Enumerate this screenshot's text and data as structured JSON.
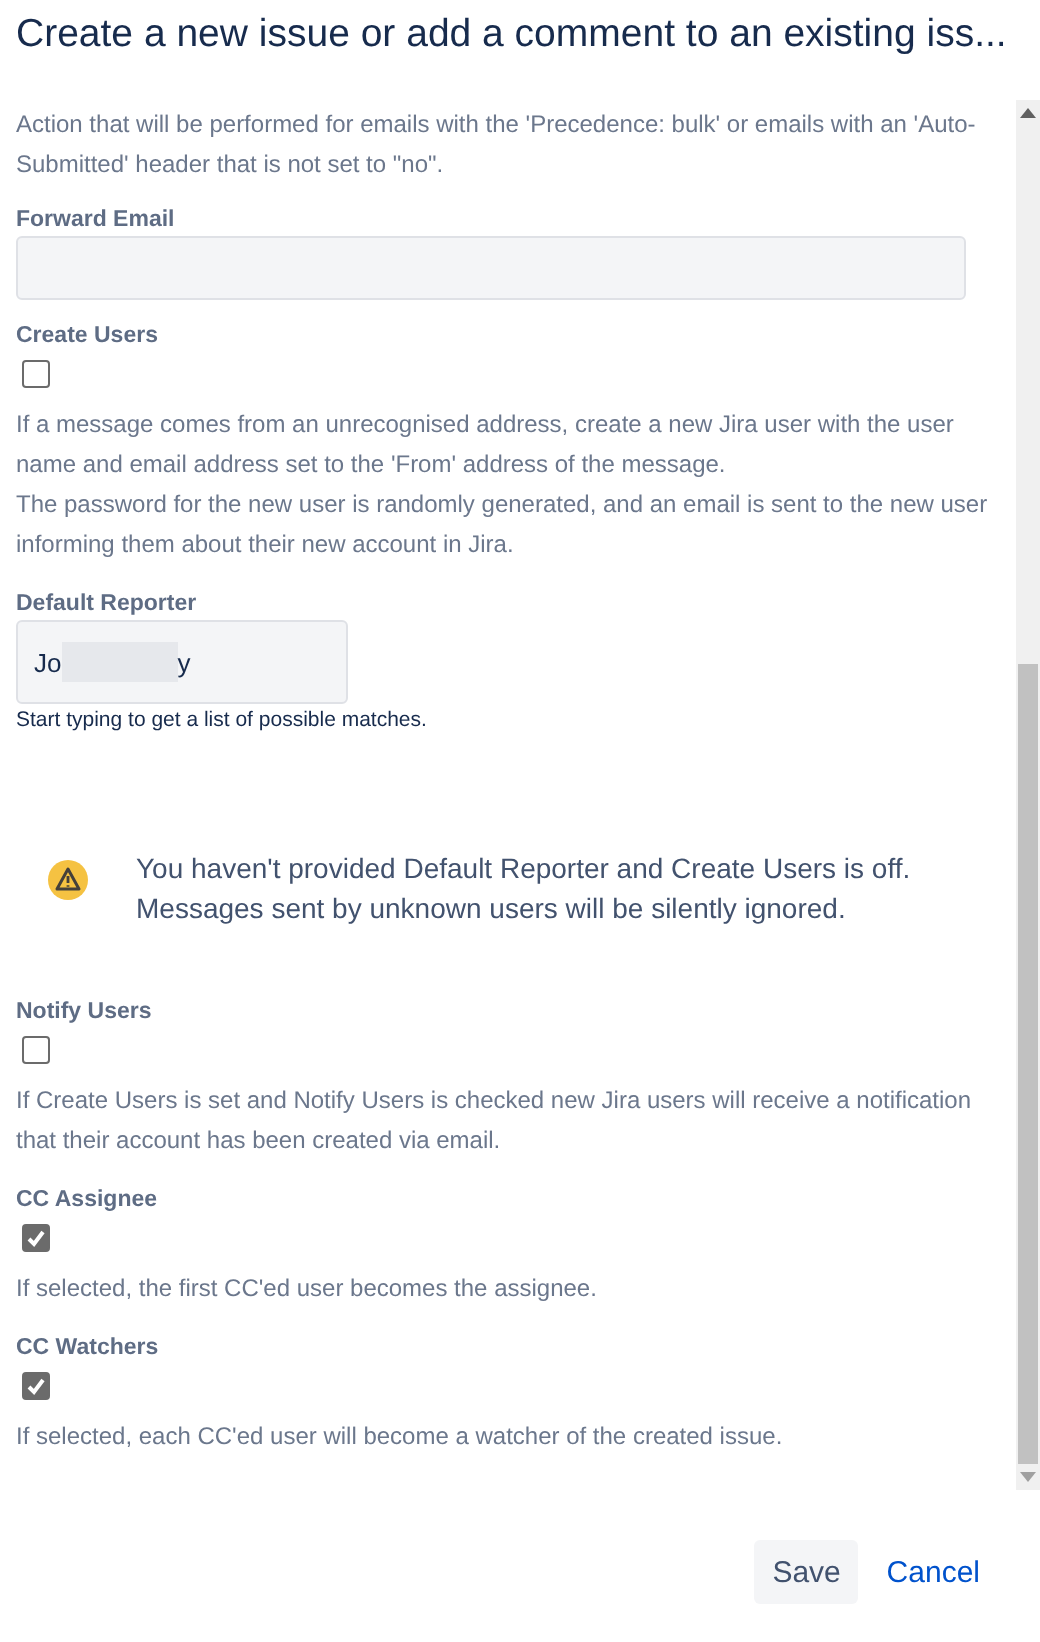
{
  "dialog": {
    "title": "Create a new issue or add a comment to an existing iss..."
  },
  "fields": [
    {
      "kind": "text",
      "description": "Action that will be performed for emails with the 'Precedence: bulk' or emails with an 'Auto-Submitted' header that is not set to \"no\"."
    },
    {
      "kind": "input",
      "label": "Forward Email"
    },
    {
      "kind": "checkbox",
      "label": "Create Users",
      "checked": false,
      "description": [
        "If a message comes from an unrecognised address, create a new Jira user with the user name and email address set to the 'From' address of the message.",
        "The password for the new user is randomly generated, and an email is sent to the new user informing them about their new account in Jira."
      ]
    },
    {
      "kind": "user",
      "label": "Default Reporter",
      "value_start": "Jo",
      "value_end": "y",
      "hint": "Start typing to get a list of possible matches."
    },
    {
      "kind": "warning",
      "message": "You haven't provided Default Reporter and Create Users is off. Messages sent by unknown users will be silently ignored."
    },
    {
      "kind": "checkbox",
      "label": "Notify Users",
      "checked": false,
      "description": [
        "If Create Users is set and Notify Users is checked new Jira users will receive a notification that their account has been created via email."
      ]
    },
    {
      "kind": "checkbox",
      "label": "CC Assignee",
      "checked": true,
      "description": [
        "If selected, the first CC'ed user becomes the assignee."
      ]
    },
    {
      "kind": "checkbox",
      "label": "CC Watchers",
      "checked": true,
      "description": [
        "If selected, each CC'ed user will become a watcher of the created issue."
      ]
    }
  ],
  "buttons": [
    {
      "kind": "primary",
      "label": "Save"
    },
    {
      "kind": "link",
      "label": "Cancel"
    }
  ]
}
